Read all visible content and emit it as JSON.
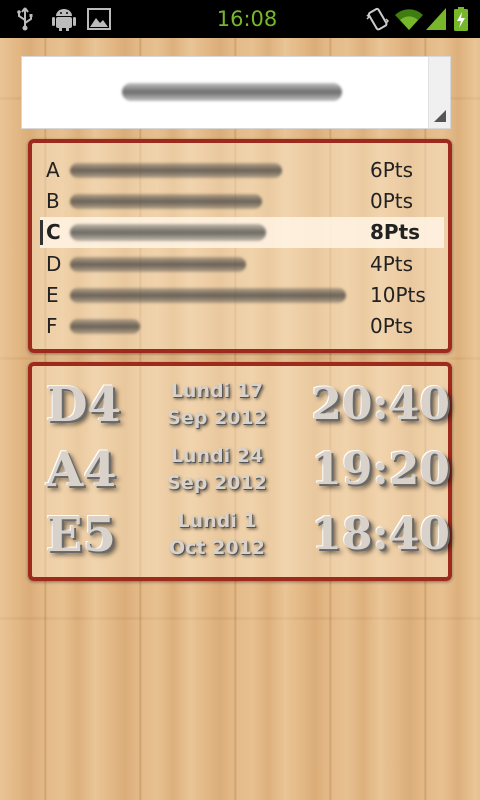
{
  "status_bar": {
    "time": "16:08",
    "icons": [
      "usb-icon",
      "android-debug-icon",
      "image-notification-icon",
      "vibrate-icon",
      "wifi-icon",
      "signal-icon",
      "battery-charging-icon"
    ],
    "accent_color": "#76b82a"
  },
  "spinner": {
    "selected_value": ""
  },
  "standings": {
    "rows": [
      {
        "letter": "A",
        "name": "",
        "points": "6Pts",
        "selected": false
      },
      {
        "letter": "B",
        "name": "",
        "points": "0Pts",
        "selected": false
      },
      {
        "letter": "C",
        "name": "",
        "points": "8Pts",
        "selected": true
      },
      {
        "letter": "D",
        "name": "",
        "points": "4Pts",
        "selected": false
      },
      {
        "letter": "E",
        "name": "",
        "points": "10Pts",
        "selected": false
      },
      {
        "letter": "F",
        "name": "",
        "points": "0Pts",
        "selected": false
      }
    ]
  },
  "schedule": {
    "matches": [
      {
        "court": "D4",
        "day": "Lundi 17",
        "month_year": "Sep 2012",
        "time": "20:40"
      },
      {
        "court": "A4",
        "day": "Lundi 24",
        "month_year": "Sep 2012",
        "time": "19:20"
      },
      {
        "court": "E5",
        "day": "Lundi 1",
        "month_year": "Oct 2012",
        "time": "18:40"
      }
    ]
  },
  "colors": {
    "panel_border": "#9d2a1d",
    "wood_background": "#e2b784"
  }
}
